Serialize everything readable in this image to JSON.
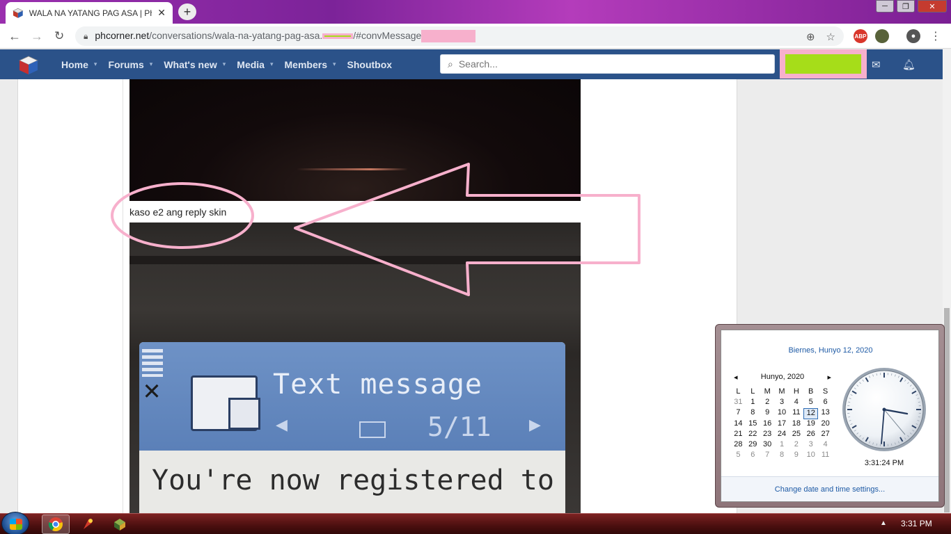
{
  "browser": {
    "tab_title": "WALA NA YATANG PAG ASA | Ph",
    "tab_close": "✕",
    "new_tab": "+",
    "url_host": "phcorner.net",
    "url_path": "/conversations/wala-na-yatang-pag-asa.",
    "url_suffix": "/#convMessage",
    "win_min": "─",
    "win_max": "❐",
    "win_close": "✕"
  },
  "site": {
    "nav": [
      {
        "label": "Home",
        "has_caret": true
      },
      {
        "label": "Forums",
        "has_caret": true
      },
      {
        "label": "What's new",
        "has_caret": true
      },
      {
        "label": "Media",
        "has_caret": true
      },
      {
        "label": "Members",
        "has_caret": true
      },
      {
        "label": "Shoutbox",
        "has_caret": false
      }
    ],
    "search_placeholder": "Search...",
    "caret": "▾"
  },
  "post": {
    "caption": "kaso e2 ang reply skin",
    "phone_screen": {
      "title": "Text message",
      "counter": "5/11",
      "body": "You're now registered to"
    }
  },
  "calendar": {
    "full_date": "Biernes, Hunyo 12, 2020",
    "month_label": "Hunyo, 2020",
    "prev": "◂",
    "next": "▸",
    "weekdays": [
      "L",
      "L",
      "M",
      "M",
      "H",
      "B",
      "S"
    ],
    "weeks": [
      [
        "31",
        "1",
        "2",
        "3",
        "4",
        "5",
        "6"
      ],
      [
        "7",
        "8",
        "9",
        "10",
        "11",
        "12",
        "13"
      ],
      [
        "14",
        "15",
        "16",
        "17",
        "18",
        "19",
        "20"
      ],
      [
        "21",
        "22",
        "23",
        "24",
        "25",
        "26",
        "27"
      ],
      [
        "28",
        "29",
        "30",
        "1",
        "2",
        "3",
        "4"
      ],
      [
        "5",
        "6",
        "7",
        "8",
        "9",
        "10",
        "11"
      ]
    ],
    "today": "12",
    "time": "3:31:24 PM",
    "settings_link": "Change date and time settings..."
  },
  "taskbar": {
    "clock": "3:31 PM",
    "tray_arrow": "▲"
  },
  "colors": {
    "site_nav": "#2b5289",
    "annotation_pink": "#f7b0cc",
    "redaction_green": "#a6dd19"
  },
  "icons": [
    "back-icon",
    "forward-icon",
    "reload-icon",
    "lock-icon",
    "add-icon",
    "star-icon",
    "adblock-icon",
    "profile-icon",
    "menu-icon",
    "search-icon",
    "mail-icon",
    "bell-icon",
    "chrome-icon",
    "start-icon"
  ]
}
